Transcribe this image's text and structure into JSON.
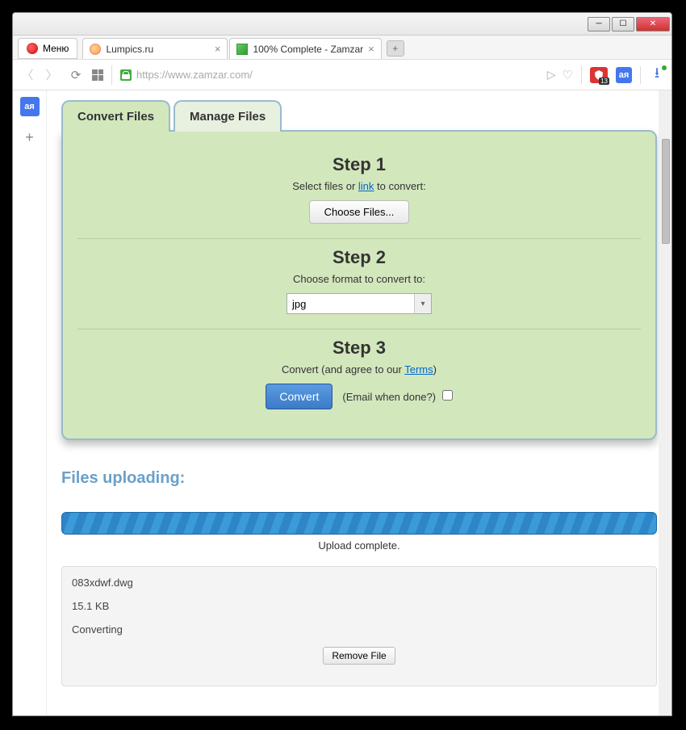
{
  "browser": {
    "menu_label": "Меню",
    "tabs": [
      {
        "title": "Lumpics.ru"
      },
      {
        "title": "100% Complete - Zamzar"
      }
    ],
    "url": "https://www.zamzar.com/",
    "shield_badge": "13",
    "translate_glyph": "aя"
  },
  "app_tabs": {
    "convert": "Convert Files",
    "manage": "Manage Files"
  },
  "step1": {
    "title": "Step 1",
    "sub_pre": "Select files or ",
    "link": "link",
    "sub_post": " to convert:",
    "button": "Choose Files..."
  },
  "step2": {
    "title": "Step 2",
    "sub": "Choose format to convert to:",
    "selected": "jpg"
  },
  "step3": {
    "title": "Step 3",
    "sub_pre": "Convert (and agree to our ",
    "terms": "Terms",
    "sub_post": ")",
    "button": "Convert",
    "email_label": "(Email when done?)"
  },
  "upload": {
    "heading": "Files uploading:",
    "status": "Upload complete."
  },
  "file": {
    "name": "083xdwf.dwg",
    "size": "15.1 KB",
    "state": "Converting",
    "remove": "Remove File"
  }
}
